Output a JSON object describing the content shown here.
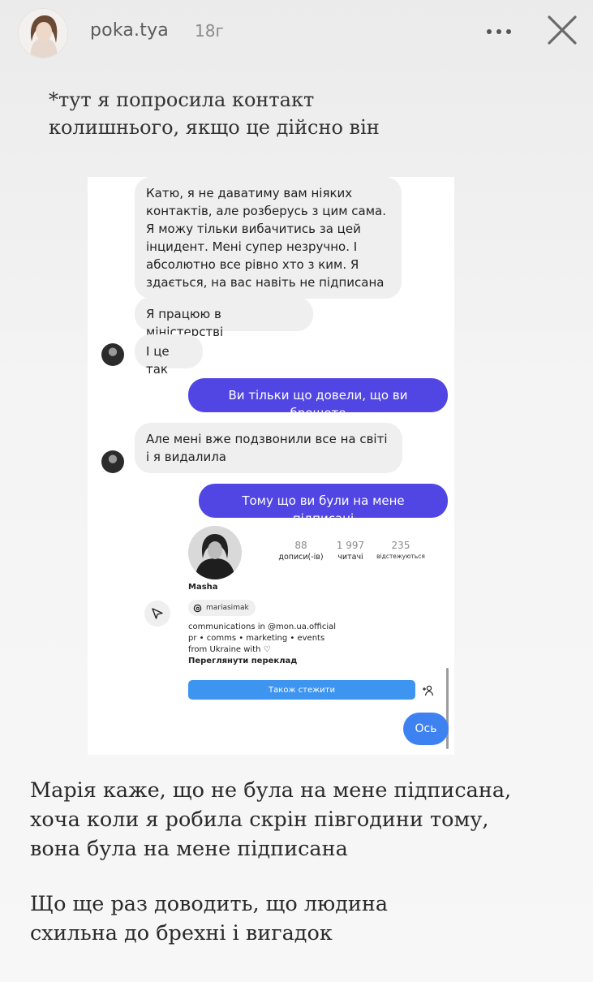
{
  "header": {
    "username": "poka.tya",
    "time": "18г"
  },
  "caption_top": [
    "*тут я попросила контакт",
    "колишнього, якщо це дійсно він"
  ],
  "chat": {
    "messages": [
      {
        "side": "in",
        "lines": [
          "Катю, я не даватиму вам ніяких",
          "контактів, але розберусь з цим сама.",
          "Я можу тільки вибачитись за цей",
          "інцидент. Мені супер незручно. І",
          "абсолютно все рівно хто з ким. Я",
          "здається, на вас навіть не підписана"
        ]
      },
      {
        "side": "in",
        "lines": [
          "Я працюю в міністерстві"
        ]
      },
      {
        "side": "in",
        "lines": [
          "І це так"
        ]
      },
      {
        "side": "out",
        "lines": [
          "Ви тільки що довели, що ви брешете"
        ]
      },
      {
        "side": "in",
        "lines": [
          "Але мені вже подзвонили все на світі",
          "і я видалила"
        ]
      },
      {
        "side": "out",
        "lines": [
          "Тому що ви були на мене підписані"
        ]
      }
    ],
    "profile": {
      "stats": [
        {
          "num": "88",
          "label": "дописи(-ів)"
        },
        {
          "num": "1 997",
          "label": "читачі"
        },
        {
          "num": "235",
          "label": "відстежуються"
        }
      ],
      "name": "Masha",
      "threads_handle": "mariasimak",
      "bio": [
        "communications in @mon.ua.official",
        "pr • comms • marketing • events",
        "from Ukraine with ♡"
      ],
      "translate": "Переглянути переклад",
      "follow_button": "Також стежити"
    },
    "last_message": "Ось"
  },
  "caption_bottom": {
    "paragraph1": [
      "Марія каже, що не була на мене підписана,",
      "хоча коли я робила скрін півгодини тому,",
      "вона була на мене підписана"
    ],
    "paragraph2": [
      "Що ще раз доводить, що людина",
      "схильна до брехні і вигадок"
    ]
  }
}
